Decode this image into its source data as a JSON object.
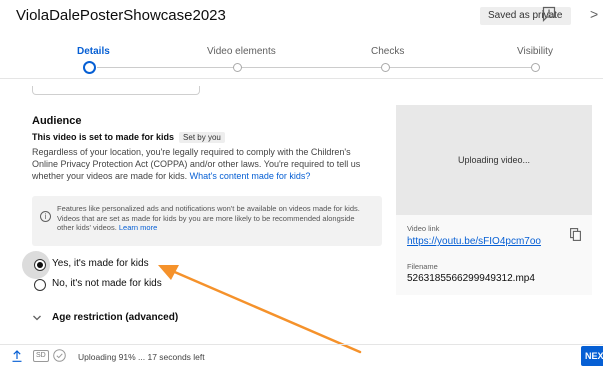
{
  "header": {
    "title": "ViolaDalePosterShowcase2023",
    "saved_label": "Saved as private"
  },
  "stepper": {
    "steps": [
      {
        "label": "Details",
        "active": true
      },
      {
        "label": "Video elements",
        "active": false
      },
      {
        "label": "Checks",
        "active": false
      },
      {
        "label": "Visibility",
        "active": false
      }
    ]
  },
  "audience": {
    "heading": "Audience",
    "subheading": "This video is set to made for kids",
    "set_by": "Set by you",
    "description": "Regardless of your location, you're legally required to comply with the Children's Online Privacy Protection Act (COPPA) and/or other laws. You're required to tell us whether your videos are made for kids.",
    "description_link": "What's content made for kids?",
    "info_text": "Features like personalized ads and notifications won't be available on videos made for kids. Videos that are set as made for kids by you are more likely to be recommended alongside other kids' videos.",
    "info_link": "Learn more",
    "options": [
      {
        "label": "Yes, it's made for kids",
        "checked": true
      },
      {
        "label": "No, it's not made for kids",
        "checked": false
      }
    ],
    "age_restriction_label": "Age restriction (advanced)"
  },
  "preview": {
    "status": "Uploading video...",
    "video_link_label": "Video link",
    "video_link": "https://youtu.be/sFIO4pcm7oo",
    "filename_label": "Filename",
    "filename": "5263185566299949312.mp4"
  },
  "footer": {
    "sd_badge": "SD",
    "status": "Uploading 91% ... 17 seconds left",
    "upload_progress": 91,
    "next_label": "NEXT"
  },
  "colors": {
    "accent": "#065fd4",
    "annotation_arrow": "#f5922b"
  }
}
